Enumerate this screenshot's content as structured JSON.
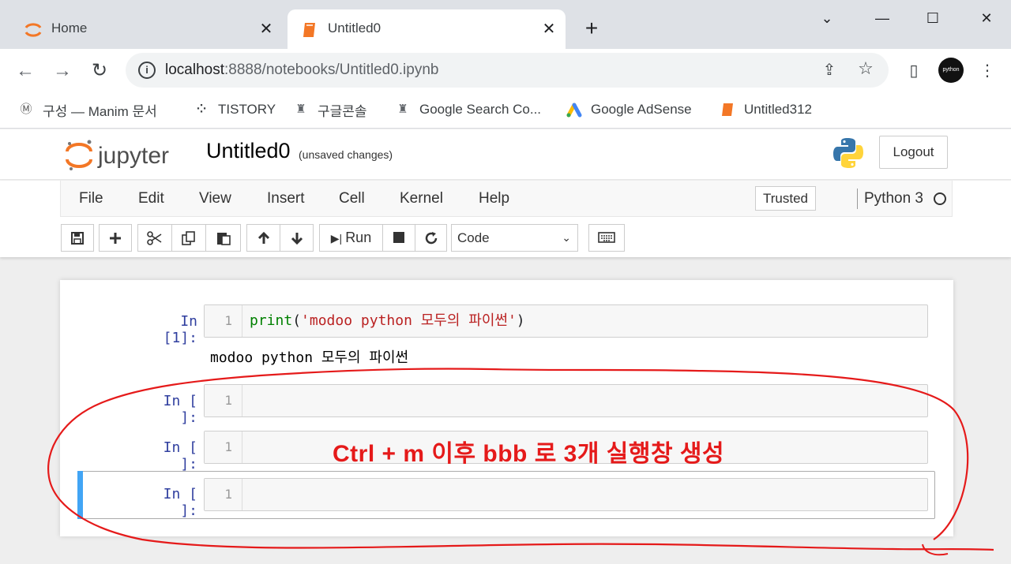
{
  "browser": {
    "tabs": [
      {
        "title": "Home",
        "active": false,
        "favicon": "jupyter-icon"
      },
      {
        "title": "Untitled0",
        "active": true,
        "favicon": "notebook-icon"
      }
    ],
    "url_host": "localhost",
    "url_path": ":8888/notebooks/Untitled0.ipynb",
    "profile_label": "python",
    "bookmarks": [
      {
        "label": "구성 — Manim 문서",
        "icon": "manim-icon"
      },
      {
        "label": "TISTORY",
        "icon": "tistory-icon"
      },
      {
        "label": "구글콘솔",
        "icon": "console-icon"
      },
      {
        "label": "Google Search Co...",
        "icon": "search-console-icon"
      },
      {
        "label": "Google AdSense",
        "icon": "adsense-icon"
      },
      {
        "label": "Untitled312",
        "icon": "notebook-icon"
      }
    ]
  },
  "jupyter": {
    "logo_text": "jupyter",
    "notebook_name": "Untitled0",
    "unsaved": "(unsaved changes)",
    "logout": "Logout",
    "menus": [
      "File",
      "Edit",
      "View",
      "Insert",
      "Cell",
      "Kernel",
      "Help"
    ],
    "trusted": "Trusted",
    "kernel": "Python 3",
    "run_label": "Run",
    "cell_type": "Code"
  },
  "cells": [
    {
      "prompt": "In [1]:",
      "line": "1",
      "code_fn": "print",
      "code_open": "(",
      "code_str": "'modoo python 모두의 파이썬'",
      "code_close": ")",
      "output": "modoo python 모두의 파이썬"
    },
    {
      "prompt": "In [ ]:",
      "line": "1"
    },
    {
      "prompt": "In [ ]:",
      "line": "1"
    },
    {
      "prompt": "In [ ]:",
      "line": "1"
    }
  ],
  "annotation": {
    "text": "Ctrl + m 이후 bbb 로 3개 실행창 생성",
    "color": "#e51a1a"
  },
  "colors": {
    "jupyter_orange": "#f37726",
    "prompt_blue": "#303f9f",
    "selected_bar": "#42a5f5"
  }
}
